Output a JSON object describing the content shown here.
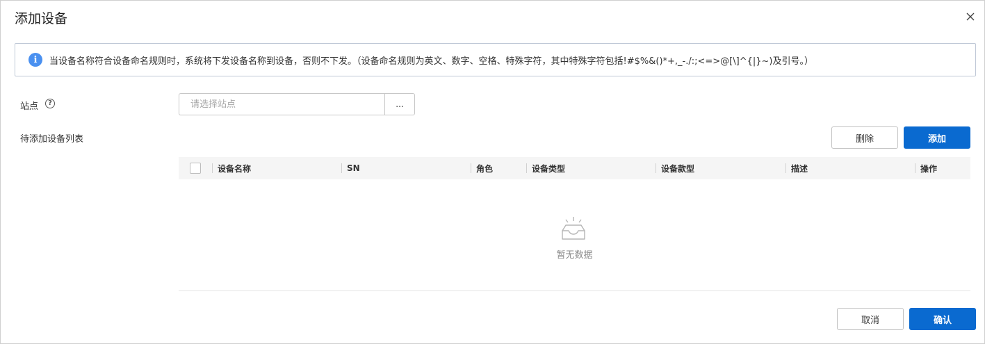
{
  "dialog": {
    "title": "添加设备"
  },
  "notice": {
    "icon": "info-icon",
    "text": "当设备名称符合设备命名规则时，系统将下发设备名称到设备，否则不下发。（设备命名规则为英文、数字、空格、特殊字符，其中特殊字符包括!#$%&()*+,_-./:;<=>@[\\]^{|}~)及引号。）"
  },
  "site": {
    "label": "站点",
    "placeholder": "请选择站点",
    "browse_label": "..."
  },
  "device_list": {
    "label": "待添加设备列表",
    "delete_label": "删除",
    "add_label": "添加",
    "columns": [
      "设备名称",
      "SN",
      "角色",
      "设备类型",
      "设备款型",
      "描述",
      "操作"
    ],
    "rows": [],
    "empty_text": "暂无数据"
  },
  "footer": {
    "cancel_label": "取消",
    "confirm_label": "确认"
  },
  "colors": {
    "primary": "#0a6ad0",
    "info": "#4a90f0"
  }
}
